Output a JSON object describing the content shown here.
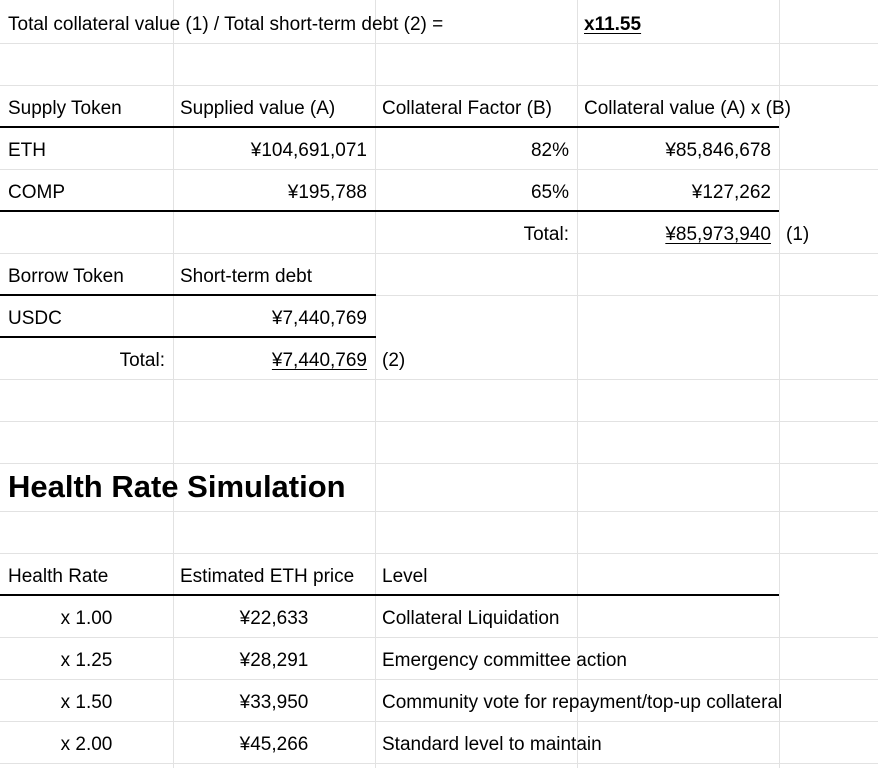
{
  "ratio": {
    "label": "Total collateral value (1) / Total short-term debt (2) =",
    "value": "x11.55"
  },
  "supply": {
    "headers": [
      "Supply Token",
      "Supplied value (A)",
      "Collateral Factor (B)",
      "Collateral value (A) x (B)"
    ],
    "rows": [
      {
        "token": "ETH",
        "supplied": "¥104,691,071",
        "factor": "82%",
        "collateral": "¥85,846,678"
      },
      {
        "token": "COMP",
        "supplied": "¥195,788",
        "factor": "65%",
        "collateral": "¥127,262"
      }
    ],
    "total_label": "Total:",
    "total_value": "¥85,973,940",
    "total_note": "(1)"
  },
  "borrow": {
    "headers": [
      "Borrow Token",
      "Short-term debt"
    ],
    "rows": [
      {
        "token": "USDC",
        "debt": "¥7,440,769"
      }
    ],
    "total_label": "Total:",
    "total_value": "¥7,440,769",
    "total_note": "(2)"
  },
  "simulation": {
    "title": "Health Rate Simulation",
    "headers": [
      "Health Rate",
      "Estimated ETH price",
      "Level"
    ],
    "rows": [
      {
        "rate": "x 1.00",
        "price": "¥22,633",
        "level": "Collateral Liquidation"
      },
      {
        "rate": "x 1.25",
        "price": "¥28,291",
        "level": "Emergency committee action"
      },
      {
        "rate": "x 1.50",
        "price": "¥33,950",
        "level": "Community vote for repayment/top-up collateral"
      },
      {
        "rate": "x 2.00",
        "price": "¥45,266",
        "level": "Standard level to maintain"
      }
    ]
  }
}
